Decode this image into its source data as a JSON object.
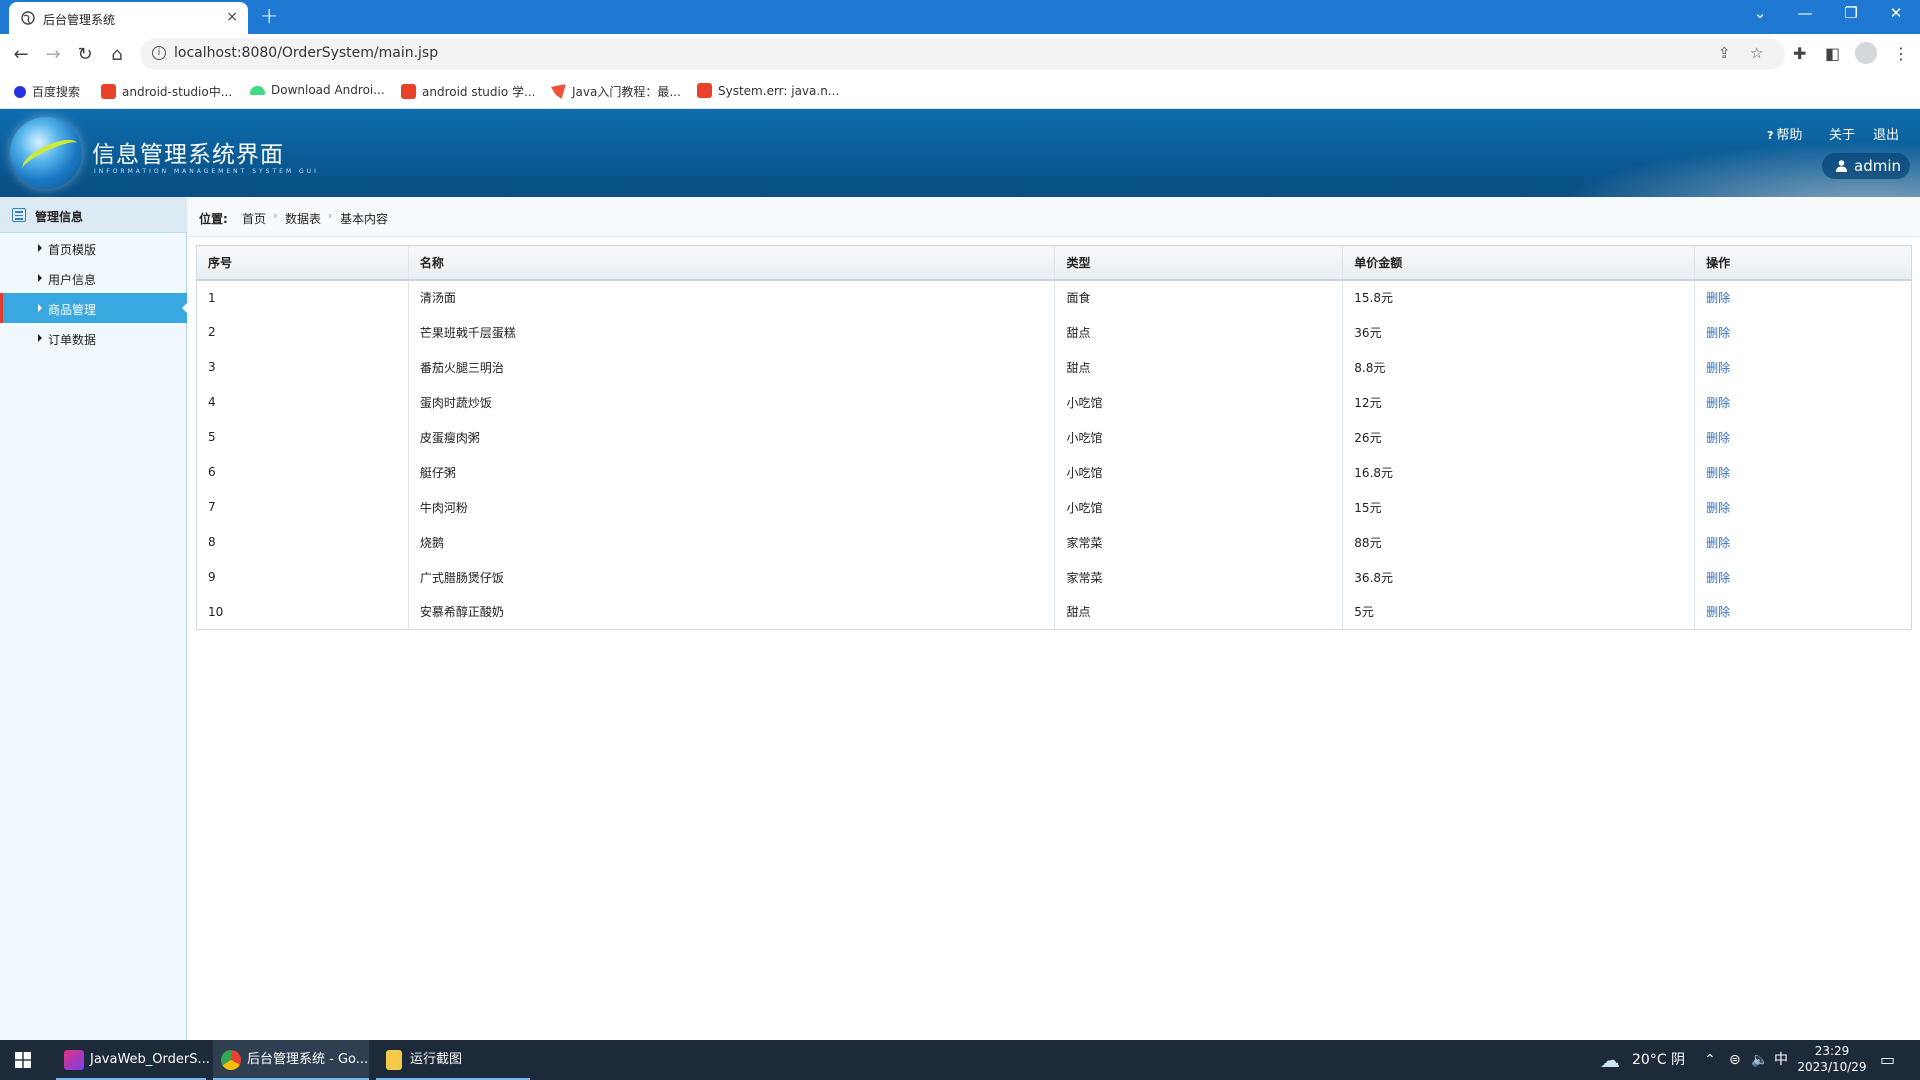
{
  "browser": {
    "tab_title": "后台管理系统",
    "tab_close": "×",
    "new_tab": "+",
    "url": "localhost:8080/OrderSystem/main.jsp",
    "win_min": "—",
    "win_restore": "❐",
    "win_close": "✕",
    "win_dropdown": "⌄",
    "bookmarks": [
      {
        "label": "百度搜索",
        "color": "#2932e1"
      },
      {
        "label": "android-studio中...",
        "color": "#e8432a"
      },
      {
        "label": "Download Androi...",
        "color": "#3ddc84"
      },
      {
        "label": "android studio 学...",
        "color": "#e8432a"
      },
      {
        "label": "Java入门教程：最...",
        "color": "#f05138"
      },
      {
        "label": "System.err: java.n...",
        "color": "#e8432a"
      }
    ]
  },
  "header": {
    "title": "信息管理系统界面",
    "subtitle": "INFORMATION MANAGEMENT SYSTEM GUI",
    "links": {
      "help": "帮助",
      "about": "关于",
      "logout": "退出"
    },
    "help_mark": "?",
    "user": "admin"
  },
  "sidebar": {
    "title": "管理信息",
    "items": [
      {
        "label": "首页模版",
        "active": false
      },
      {
        "label": "用户信息",
        "active": false
      },
      {
        "label": "商品管理",
        "active": true
      },
      {
        "label": "订单数据",
        "active": false
      }
    ]
  },
  "breadcrumb": {
    "prefix": "位置:",
    "items": [
      "首页",
      "数据表",
      "基本内容"
    ],
    "sep": "›"
  },
  "table": {
    "headers": [
      "序号",
      "名称",
      "类型",
      "单价金额",
      "操作"
    ],
    "rows": [
      [
        "1",
        "清汤面",
        "面食",
        "15.8元",
        "删除"
      ],
      [
        "2",
        "芒果班戟千层蛋糕",
        "甜点",
        "36元",
        "删除"
      ],
      [
        "3",
        "番茄火腿三明治",
        "甜点",
        "8.8元",
        "删除"
      ],
      [
        "4",
        "蛋肉时蔬炒饭",
        "小吃馆",
        "12元",
        "删除"
      ],
      [
        "5",
        "皮蛋瘦肉粥",
        "小吃馆",
        "26元",
        "删除"
      ],
      [
        "6",
        "艇仔粥",
        "小吃馆",
        "16.8元",
        "删除"
      ],
      [
        "7",
        "牛肉河粉",
        "小吃馆",
        "15元",
        "删除"
      ],
      [
        "8",
        "烧鹅",
        "家常菜",
        "88元",
        "删除"
      ],
      [
        "9",
        "广式腊肠煲仔饭",
        "家常菜",
        "36.8元",
        "删除"
      ],
      [
        "10",
        "安慕希醇正酸奶",
        "甜点",
        "5元",
        "删除"
      ]
    ]
  },
  "taskbar": {
    "apps": [
      {
        "label": "JavaWeb_OrderS...",
        "color": "#e0337a"
      },
      {
        "label": "后台管理系统 - Go...",
        "color": "#f4b400"
      },
      {
        "label": "运行截图",
        "color": "#f6c94a"
      }
    ],
    "weather": "20°C 阴",
    "ime": "中",
    "time": "23:29",
    "date": "2023/10/29"
  }
}
